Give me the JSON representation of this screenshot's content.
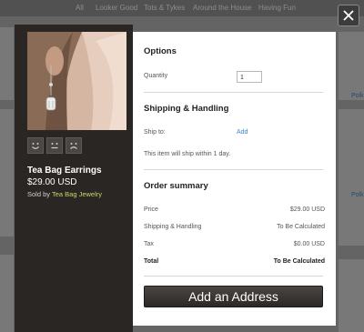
{
  "background": {
    "nav_items": [
      "All",
      "Looker Good",
      "Tots & Tykes",
      "Around the House",
      "Having Fun"
    ],
    "side_snippets": [
      "Polk",
      "Polk"
    ]
  },
  "modal": {
    "close_icon": "close-icon",
    "product": {
      "title": "Tea Bag Earrings",
      "price": "$29.00 USD",
      "sold_by_label": "Sold by",
      "shop_name": "Tea Bag Jewelry",
      "feedback_icons": [
        "smile-icon",
        "neutral-face-icon",
        "frown-icon"
      ]
    },
    "options": {
      "title": "Options",
      "quantity_label": "Quantity",
      "quantity_value": "1"
    },
    "shipping": {
      "title": "Shipping & Handling",
      "ship_to_label": "Ship to:",
      "add_link": "Add",
      "note": "This item will ship within 1 day."
    },
    "summary": {
      "title": "Order summary",
      "rows": [
        {
          "label": "Price",
          "value": "$29.00 USD"
        },
        {
          "label": "Shipping & Handling",
          "value": "To Be Calculated"
        },
        {
          "label": "Tax",
          "value": "$0.00 USD"
        }
      ],
      "total_label": "Total",
      "total_value": "To Be Calculated"
    },
    "add_address_button": "Add an Address"
  }
}
